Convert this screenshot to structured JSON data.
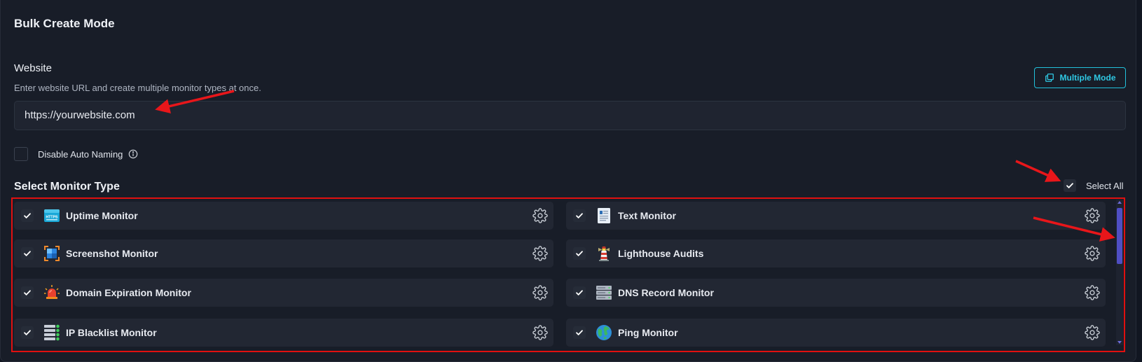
{
  "page": {
    "title": "Bulk Create Mode"
  },
  "website": {
    "label": "Website",
    "help": "Enter website URL and create multiple monitor types at once.",
    "value": "https://yourwebsite.com",
    "multiple_mode_label": "Multiple Mode"
  },
  "auto_naming": {
    "label": "Disable Auto Naming",
    "checked": false
  },
  "monitor_types": {
    "title": "Select Monitor Type",
    "select_all_label": "Select All",
    "select_all_checked": true,
    "items": [
      {
        "label": "Uptime Monitor",
        "icon": "https-icon",
        "checked": true
      },
      {
        "label": "Text Monitor",
        "icon": "text-document-icon",
        "checked": true
      },
      {
        "label": "Screenshot Monitor",
        "icon": "screenshot-icon",
        "checked": true
      },
      {
        "label": "Lighthouse Audits",
        "icon": "lighthouse-icon",
        "checked": true
      },
      {
        "label": "Domain Expiration Monitor",
        "icon": "siren-icon",
        "checked": true
      },
      {
        "label": "DNS Record Monitor",
        "icon": "server-rack-icon",
        "checked": true
      },
      {
        "label": "IP Blacklist Monitor",
        "icon": "server-list-icon",
        "checked": true
      },
      {
        "label": "Ping Monitor",
        "icon": "globe-icon",
        "checked": true
      }
    ]
  },
  "colors": {
    "accent": "#22c1dc",
    "highlight": "#e01010",
    "scroll_thumb": "#4f4ec3"
  }
}
